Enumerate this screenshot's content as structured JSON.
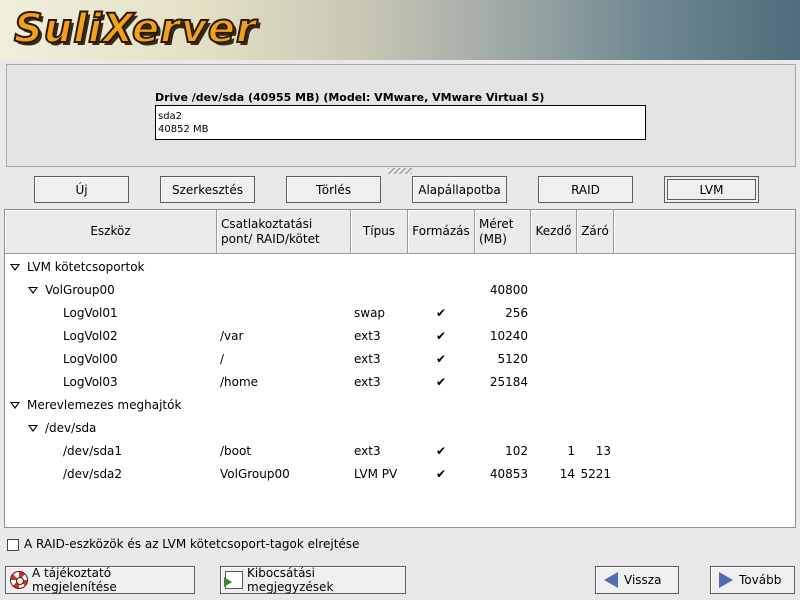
{
  "app": {
    "logo_text": "SuliXerver",
    "colors": {
      "logo": "#f2a21a",
      "arrow": "#4d6db0"
    }
  },
  "drive": {
    "title": "Drive /dev/sda (40955 MB) (Model: VMware, VMware Virtual S)",
    "segment_name": "sda2",
    "segment_size": "40852 MB"
  },
  "toolbar": {
    "buttons": [
      {
        "label": "Új"
      },
      {
        "label": "Szerkesztés"
      },
      {
        "label": "Törlés"
      },
      {
        "label": "Alapállapotba"
      },
      {
        "label": "RAID"
      },
      {
        "label": "LVM"
      }
    ]
  },
  "table": {
    "columns": [
      "Eszköz",
      "Csatlakoztatási pont/ RAID/kötet",
      "Típus",
      "Formázás",
      "Méret (MB)",
      "Kezdő",
      "Záró"
    ],
    "groups": [
      {
        "label": "LVM kötetcsoportok"
      },
      {
        "label": "Merevlemezes meghajtók"
      }
    ],
    "rows": [
      {
        "device": "VolGroup00",
        "mount": "",
        "type": "",
        "format": "",
        "size": "40800",
        "start": "",
        "end": ""
      },
      {
        "device": "LogVol01",
        "mount": "",
        "type": "swap",
        "format": "✔",
        "size": "256",
        "start": "",
        "end": ""
      },
      {
        "device": "LogVol02",
        "mount": "/var",
        "type": "ext3",
        "format": "✔",
        "size": "10240",
        "start": "",
        "end": ""
      },
      {
        "device": "LogVol00",
        "mount": "/",
        "type": "ext3",
        "format": "✔",
        "size": "5120",
        "start": "",
        "end": ""
      },
      {
        "device": "LogVol03",
        "mount": "/home",
        "type": "ext3",
        "format": "✔",
        "size": "25184",
        "start": "",
        "end": ""
      },
      {
        "device": "/dev/sda",
        "mount": "",
        "type": "",
        "format": "",
        "size": "",
        "start": "",
        "end": ""
      },
      {
        "device": "/dev/sda1",
        "mount": "/boot",
        "type": "ext3",
        "format": "✔",
        "size": "102",
        "start": "1",
        "end": "13"
      },
      {
        "device": "/dev/sda2",
        "mount": "VolGroup00",
        "type": "LVM PV",
        "format": "✔",
        "size": "40853",
        "start": "14",
        "end": "5221"
      }
    ]
  },
  "options": {
    "hide_label": "A RAID-eszközök és az LVM kötetcsoport-tagok elrejtése"
  },
  "footer": {
    "info_label": "A tájékoztató megjelenítése",
    "notes_label": "Kibocsátási megjegyzések",
    "back_label": "Vissza",
    "next_label": "Tovább"
  }
}
